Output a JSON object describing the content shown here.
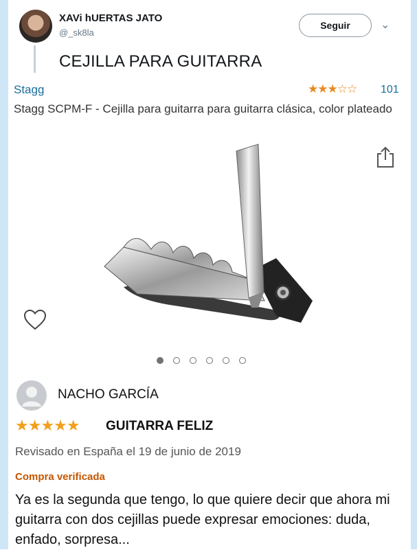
{
  "tweet": {
    "display_name": "XAVi hUERTAS JATO",
    "handle": "@_sk8la",
    "follow_label": "Seguir",
    "text": "CEJILLA PARA GUITARRA"
  },
  "product": {
    "brand": "Stagg",
    "rating_stars": 3.5,
    "rating_count": "101",
    "title": "Stagg SCPM-F - Cejilla para guitarra para guitarra clásica, color plateado",
    "carousel_total": 6,
    "carousel_active": 1
  },
  "review": {
    "reviewer": "NACHO GARCÍA",
    "stars": 5,
    "title": "GUITARRA FELIZ",
    "meta": "Revisado en España el 19 de junio de 2019",
    "verified": "Compra verificada",
    "body": "Ya es la segunda que tengo, lo que quiere decir que ahora mi guitarra con dos cejillas puede expresar emociones: duda, enfado, sorpresa..."
  },
  "colors": {
    "link_blue": "#1a6e9e",
    "star_orange": "#f29f1a",
    "verified_orange": "#c45500"
  }
}
